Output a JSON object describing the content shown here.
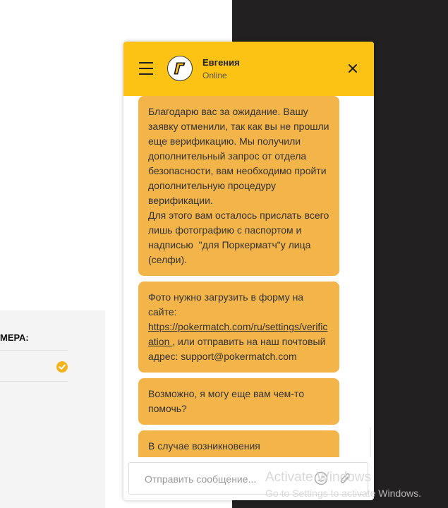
{
  "page": {
    "panel_label": "МЕРА:"
  },
  "chat": {
    "agent_name": "Евгения",
    "agent_status": "Online",
    "messages": [
      {
        "text": "Благодарю вас за ожидание. Вашу заявку отменили, так как вы не прошли еще верификацию. Мы получили дополнительный запрос от отдела безопасности, вам необходимо пройти дополнительную процедуру верификации.\nДля этого вам осталось прислать всего лишь фотографию с паспортом и надписью  \"для Поркерматч\"у лица (селфи)."
      },
      {
        "text_before": "Фото нужно загрузить в форму на сайте: ",
        "link": "https://pokermatch.com/ru/settings/verification ",
        "text_after": ", или отправить на наш почтовый адрес: support@pokermatch.com"
      },
      {
        "text": "Возможно, я могу еще вам чем-то помочь?"
      },
      {
        "text": "В случае возникновения"
      }
    ],
    "input_placeholder": "Отправить сообщение..."
  },
  "watermark": {
    "title": "Activate Windows",
    "subtitle": "Go to Settings to activate Windows."
  },
  "colors": {
    "header": "#fcc314",
    "bubble": "#f3b54a",
    "check": "#f3b31b",
    "dark_bg": "#222020"
  },
  "icons": [
    "menu-icon",
    "logo-icon",
    "close-icon",
    "check-icon",
    "smile-icon",
    "attach-icon"
  ]
}
